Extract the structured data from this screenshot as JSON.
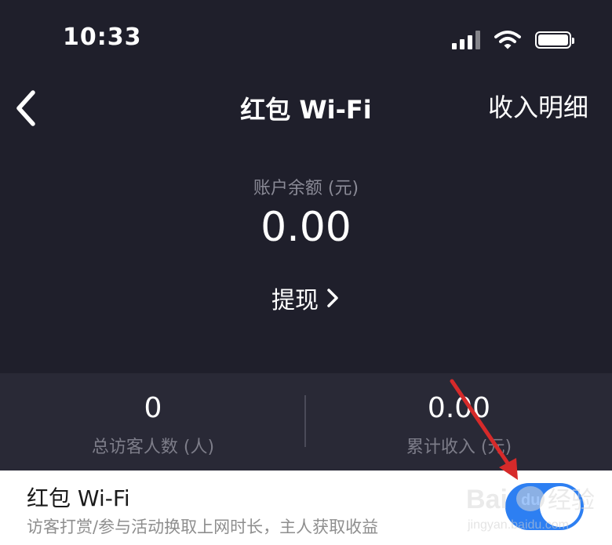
{
  "status_bar": {
    "time": "10:33",
    "icons": [
      "cellular-signal-icon",
      "wifi-icon",
      "battery-icon"
    ]
  },
  "nav": {
    "back_icon": "chevron-left-icon",
    "title": "红包 Wi-Fi",
    "action_label": "收入明细"
  },
  "balance": {
    "label": "账户余额 (元)",
    "value": "0.00"
  },
  "withdraw": {
    "label": "提现",
    "icon": "chevron-right-icon"
  },
  "stats": [
    {
      "value": "0",
      "label": "总访客人数 (人)"
    },
    {
      "value": "0.00",
      "label": "累计收入 (元)"
    }
  ],
  "feature": {
    "title": "红包 Wi-Fi",
    "description": "访客打赏/参与活动换取上网时长，主人获取收益",
    "toggle_on": true
  },
  "colors": {
    "background": "#1f1f2b",
    "stats_background": "#292936",
    "toggle_on": "#2d7ff2",
    "annotation_arrow": "#d62a2a"
  },
  "watermark": {
    "logo_text": "Bai du 经验",
    "url_text": "jingyan.baidu.com"
  }
}
